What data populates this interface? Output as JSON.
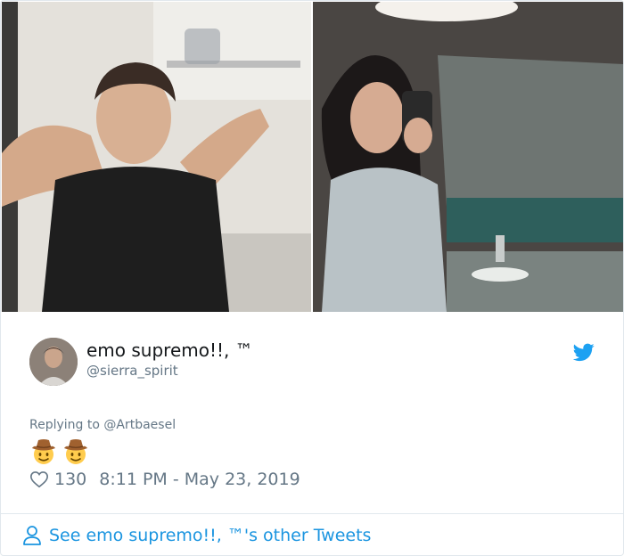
{
  "tweet": {
    "author_name": "emo supremo!!, ™",
    "author_handle": "@sierra_spirit",
    "reply_prefix": "Replying to",
    "reply_to": "@Artbaesel",
    "emojis": [
      "cowboy-hat-face",
      "cowboy-hat-face"
    ],
    "likes": "130",
    "timestamp": "8:11 PM - May 23, 2019",
    "see_more": "See emo supremo!!, ™'s other Tweets"
  },
  "colors": {
    "link": "#1b95e0",
    "muted": "#657786",
    "text": "#14171a",
    "twitter_blue": "#1da1f2"
  }
}
